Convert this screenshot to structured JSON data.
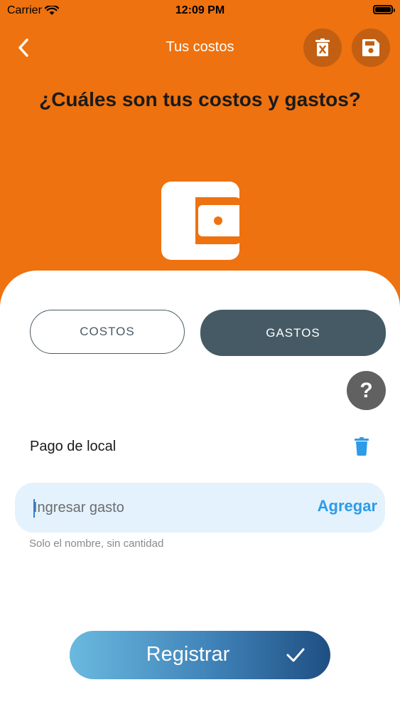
{
  "status_bar": {
    "carrier": "Carrier",
    "time": "12:09 PM"
  },
  "nav": {
    "title": "Tus costos"
  },
  "header": {
    "question": "¿Cuáles son tus costos y gastos?"
  },
  "tabs": [
    {
      "label": "COSTOS",
      "selected": false
    },
    {
      "label": "GASTOS",
      "selected": true
    }
  ],
  "help": {
    "label": "?"
  },
  "items": [
    {
      "label": "Pago de local"
    }
  ],
  "input": {
    "value": "",
    "placeholder": "Ingresar gasto",
    "add_label": "Agregar",
    "hint": "Solo el nombre, sin cantidad"
  },
  "register": {
    "label": "Registrar"
  },
  "colors": {
    "primary_orange": "#EE720F",
    "dark_orange": "#C25F13",
    "tab_selected": "#455A64",
    "accent_blue": "#2E9BE8",
    "input_bg": "#E4F2FD"
  },
  "icons": {
    "back": "chevron-left-icon",
    "delete_all": "trash-x-icon",
    "save": "floppy-disk-icon",
    "wallet": "wallet-icon",
    "item_delete": "trash-icon",
    "register": "checkmark-icon"
  }
}
